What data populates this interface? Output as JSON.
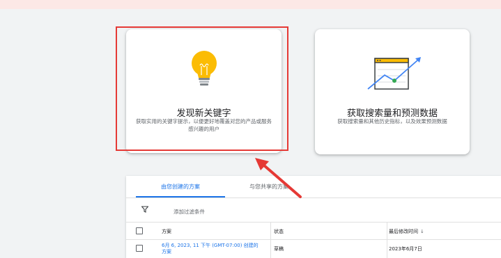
{
  "banner": {
    "text": ""
  },
  "cards": [
    {
      "title": "发现新关键字",
      "description": "获取实用的关键字提示，以便更好地覆盖对您的产品或服务感兴趣的用户",
      "icon": "lightbulb-icon"
    },
    {
      "title": "获取搜索量和预测数据",
      "description": "获取搜索量和其他历史指标，以及效果预测数据",
      "icon": "growth-chart-icon"
    }
  ],
  "tabs": [
    {
      "label": "由您创建的方案",
      "active": true
    },
    {
      "label": "与您共享的方案",
      "active": false
    }
  ],
  "filter": {
    "label": "添加过滤条件"
  },
  "table": {
    "headers": {
      "plan": "方案",
      "status": "状态",
      "last_modified": "最后修改时间"
    },
    "sort_glyph": "↓",
    "rows": [
      {
        "plan": "6月 6, 2023, 11 下午 (GMT-07:00) 创建的方案",
        "status": "草稿",
        "last_modified": "2023年6月7日"
      }
    ]
  },
  "colors": {
    "accent": "#1a73e8",
    "highlight": "#e53935",
    "bulb": "#fbbc04",
    "chart_green": "#34a853"
  }
}
